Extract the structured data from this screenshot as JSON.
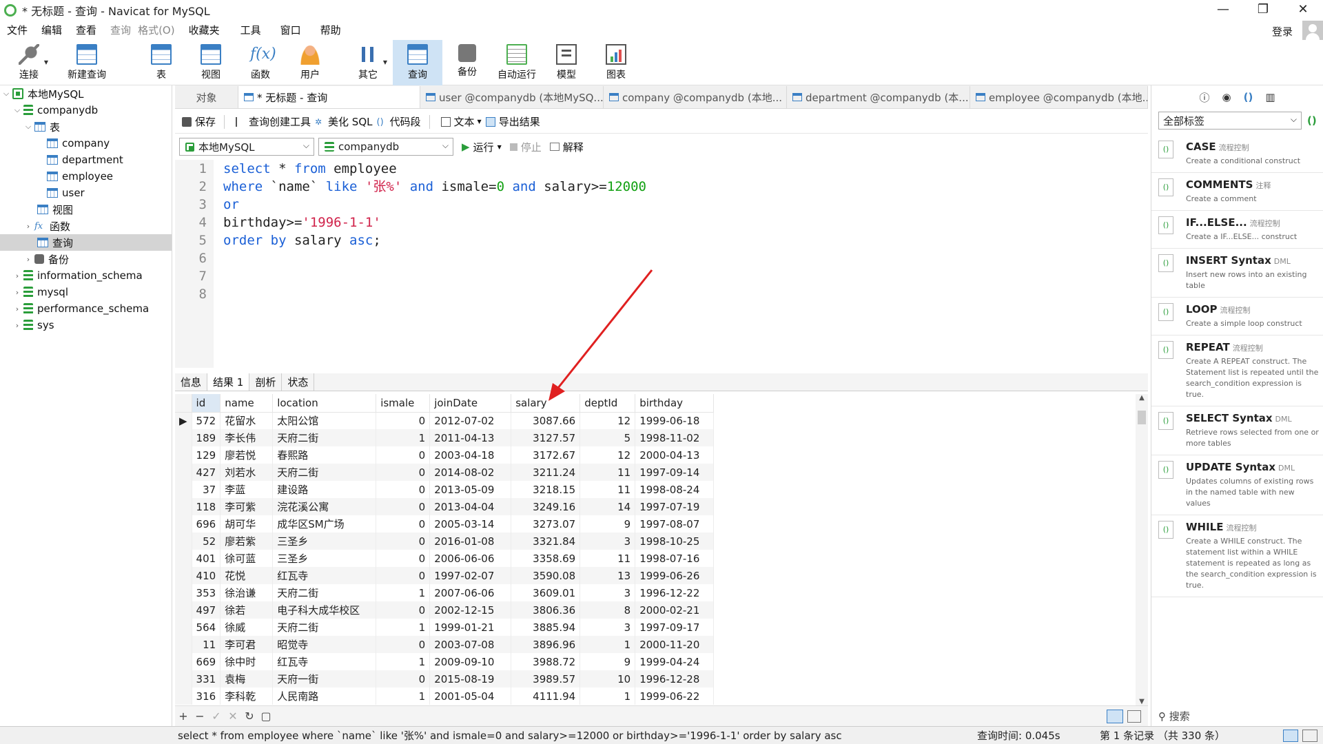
{
  "window": {
    "title": "* 无标题 - 查询 - Navicat for MySQL",
    "controls": [
      "—",
      "❐",
      "✕"
    ]
  },
  "menu": [
    "文件",
    "编辑",
    "查看",
    "查询",
    "格式(O)",
    "收藏夹",
    "工具",
    "窗口",
    "帮助"
  ],
  "login": "登录",
  "toolbar": [
    {
      "label": "连接",
      "icon": "connection-icon",
      "dropdown": true
    },
    {
      "label": "新建查询",
      "icon": "new-query-icon"
    },
    {
      "label": "表",
      "icon": "table-icon"
    },
    {
      "label": "视图",
      "icon": "view-icon"
    },
    {
      "label": "函数",
      "icon": "function-icon"
    },
    {
      "label": "用户",
      "icon": "user-icon"
    },
    {
      "label": "其它",
      "icon": "tools-icon",
      "dropdown": true
    },
    {
      "label": "查询",
      "icon": "query-icon",
      "active": true
    },
    {
      "label": "备份",
      "icon": "backup-icon"
    },
    {
      "label": "自动运行",
      "icon": "automation-icon"
    },
    {
      "label": "模型",
      "icon": "model-icon"
    },
    {
      "label": "图表",
      "icon": "chart-icon"
    }
  ],
  "tree": {
    "connection": "本地MySQL",
    "db": "companydb",
    "tables_label": "表",
    "tables": [
      "company",
      "department",
      "employee",
      "user"
    ],
    "views": "视图",
    "functions": "函数",
    "queries": "查询",
    "backups": "备份",
    "other_dbs": [
      "information_schema",
      "mysql",
      "performance_schema",
      "sys"
    ]
  },
  "tabs": [
    {
      "label": "对象"
    },
    {
      "label": "* 无标题 - 查询",
      "active": true
    },
    {
      "label": "user @companydb (本地MySQ..."
    },
    {
      "label": "company @companydb (本地..."
    },
    {
      "label": "department @companydb (本..."
    },
    {
      "label": "employee @companydb (本地..."
    }
  ],
  "query_toolbar": {
    "save": "保存",
    "builder": "查询创建工具",
    "beautify": "美化 SQL",
    "snippet": "代码段",
    "text": "文本",
    "export": "导出结果"
  },
  "selectors": {
    "connection": "本地MySQL",
    "database": "companydb",
    "run": "运行",
    "stop": "停止",
    "explain": "解释"
  },
  "editor": {
    "line_numbers": [
      "1",
      "2",
      "3",
      "4",
      "5",
      "6",
      "7",
      "8"
    ]
  },
  "result_tabs": [
    "信息",
    "结果 1",
    "剖析",
    "状态"
  ],
  "grid": {
    "columns": [
      "id",
      "name",
      "location",
      "ismale",
      "joinDate",
      "salary",
      "deptId",
      "birthday"
    ],
    "rows": [
      [
        "572",
        "花留水",
        "太阳公馆",
        "0",
        "2012-07-02",
        "3087.66",
        "12",
        "1999-06-18"
      ],
      [
        "189",
        "李长伟",
        "天府二街",
        "1",
        "2011-04-13",
        "3127.57",
        "5",
        "1998-11-02"
      ],
      [
        "129",
        "廖若悦",
        "春熙路",
        "0",
        "2003-04-18",
        "3172.67",
        "12",
        "2000-04-13"
      ],
      [
        "427",
        "刘若水",
        "天府二街",
        "0",
        "2014-08-02",
        "3211.24",
        "11",
        "1997-09-14"
      ],
      [
        "37",
        "李蓝",
        "建设路",
        "0",
        "2013-05-09",
        "3218.15",
        "11",
        "1998-08-24"
      ],
      [
        "118",
        "李可紫",
        "浣花溪公寓",
        "0",
        "2013-04-04",
        "3249.16",
        "14",
        "1997-07-19"
      ],
      [
        "696",
        "胡可华",
        "成华区SM广场",
        "0",
        "2005-03-14",
        "3273.07",
        "9",
        "1997-08-07"
      ],
      [
        "52",
        "廖若紫",
        "三圣乡",
        "0",
        "2016-01-08",
        "3321.84",
        "3",
        "1998-10-25"
      ],
      [
        "401",
        "徐可蓝",
        "三圣乡",
        "0",
        "2006-06-06",
        "3358.69",
        "11",
        "1998-07-16"
      ],
      [
        "410",
        "花悦",
        "红瓦寺",
        "0",
        "1997-02-07",
        "3590.08",
        "13",
        "1999-06-26"
      ],
      [
        "353",
        "徐治谦",
        "天府二街",
        "1",
        "2007-06-06",
        "3609.01",
        "3",
        "1996-12-22"
      ],
      [
        "497",
        "徐若",
        "电子科大成华校区",
        "0",
        "2002-12-15",
        "3806.36",
        "8",
        "2000-02-21"
      ],
      [
        "564",
        "徐威",
        "天府二街",
        "1",
        "1999-01-21",
        "3885.94",
        "3",
        "1997-09-17"
      ],
      [
        "11",
        "李可君",
        "昭觉寺",
        "0",
        "2003-07-08",
        "3896.96",
        "1",
        "2000-11-20"
      ],
      [
        "669",
        "徐中时",
        "红瓦寺",
        "1",
        "2009-09-10",
        "3988.72",
        "9",
        "1999-04-24"
      ],
      [
        "331",
        "袁梅",
        "天府一街",
        "0",
        "2015-08-19",
        "3989.57",
        "10",
        "1996-12-28"
      ],
      [
        "316",
        "李科乾",
        "人民南路",
        "1",
        "2001-05-04",
        "4111.94",
        "1",
        "1999-06-22"
      ]
    ]
  },
  "status": {
    "sql": "select * from employee where `name` like '张%' and ismale=0 and salary>=12000 or birthday>='1996-1-1' order by salary asc",
    "time": "查询时间: 0.045s",
    "records": "第 1 条记录 （共 330 条）"
  },
  "right_panel": {
    "filter": "全部标签",
    "search": "搜索",
    "snippets": [
      {
        "title": "CASE",
        "tag": "流程控制",
        "desc": "Create a conditional construct"
      },
      {
        "title": "COMMENTS",
        "tag": "注释",
        "desc": "Create a comment"
      },
      {
        "title": "IF...ELSE...",
        "tag": "流程控制",
        "desc": "Create a IF...ELSE... construct"
      },
      {
        "title": "INSERT Syntax",
        "tag": "DML",
        "desc": "Insert new rows into an existing table"
      },
      {
        "title": "LOOP",
        "tag": "流程控制",
        "desc": "Create a simple loop construct"
      },
      {
        "title": "REPEAT",
        "tag": "流程控制",
        "desc": "Create A REPEAT construct. The Statement list is repeated until the search_condition expression is true."
      },
      {
        "title": "SELECT Syntax",
        "tag": "DML",
        "desc": "Retrieve rows selected from one or more tables"
      },
      {
        "title": "UPDATE Syntax",
        "tag": "DML",
        "desc": "Updates columns of existing rows in the named table with new values"
      },
      {
        "title": "WHILE",
        "tag": "流程控制",
        "desc": "Create a WHILE construct. The statement list within a WHILE statement is repeated as long as the search_condition expression is true."
      }
    ]
  },
  "colors": {
    "keyword": "#1a5fd6",
    "string": "#d0224a",
    "number": "#11a011",
    "active_tool": "#cfe3f5",
    "annotation_arrow": "#e02020"
  }
}
